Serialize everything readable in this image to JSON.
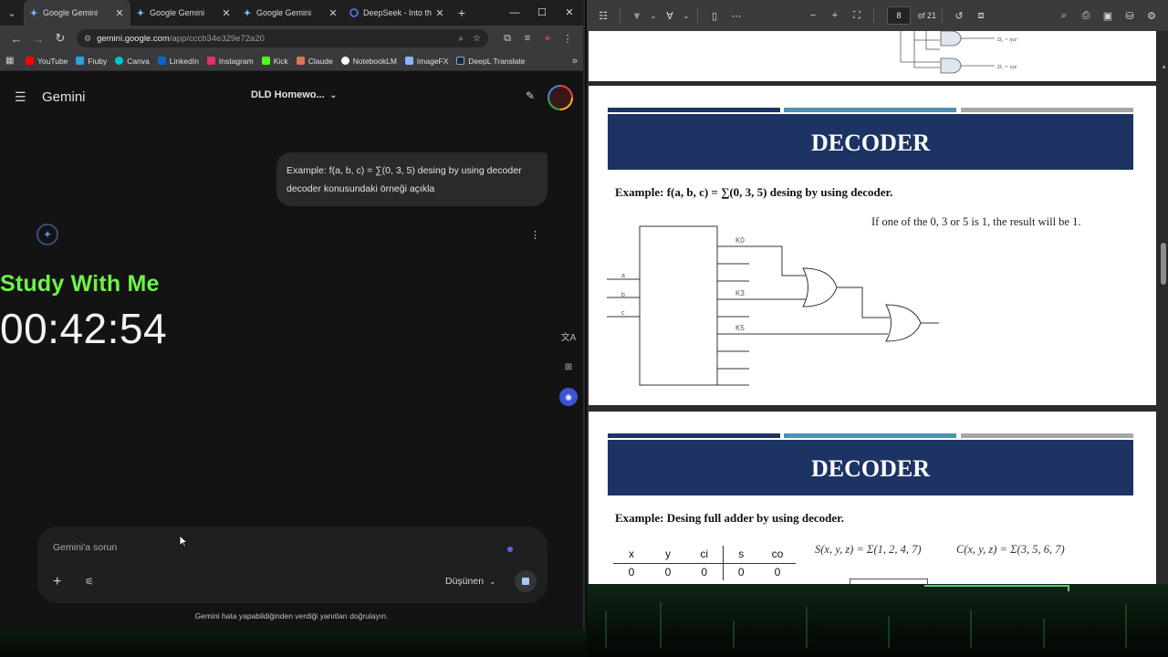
{
  "browser": {
    "tabs": [
      {
        "title": "Google Gemini",
        "active": true
      },
      {
        "title": "Google Gemini",
        "active": false
      },
      {
        "title": "Google Gemini",
        "active": false
      },
      {
        "title": "DeepSeek - Into th",
        "active": false
      }
    ],
    "url_host": "gemini.google.com",
    "url_path": "/app/cccb34e329e72a20",
    "bookmarks": [
      {
        "label": "YouTube",
        "color": "#ff0000"
      },
      {
        "label": "Fiuby",
        "color": "#2aa1e0"
      },
      {
        "label": "Canva",
        "color": "#00c4cc"
      },
      {
        "label": "LinkedIn",
        "color": "#0a66c2"
      },
      {
        "label": "Instagram",
        "color": "#e1306c"
      },
      {
        "label": "Kick",
        "color": "#53fc18"
      },
      {
        "label": "Claude",
        "color": "#d97757"
      },
      {
        "label": "NotebookLM",
        "color": "#ffffff"
      },
      {
        "label": "ImageFX",
        "color": "#8ab4f8"
      },
      {
        "label": "DeepL Translate",
        "color": "#0f2b46"
      }
    ]
  },
  "gemini": {
    "logo": "Gemini",
    "conversation_title": "DLD Homewo...",
    "user_message_line1": "Example: f(a, b, c) = ∑(0, 3, 5) desing by using decoder",
    "user_message_line2": "decoder konusundaki örneği açıkla",
    "prompt_placeholder": "Gemini'a sorun",
    "mode_label": "Düşünen",
    "disclaimer": "Gemini hata yapabildiğinden verdiği yanıtları doğrulayın."
  },
  "overlay": {
    "title": "Study With Me",
    "timer": "00:42:54"
  },
  "pdf": {
    "page_number": "8",
    "page_count": "of 21",
    "top_labels": [
      "D₆ = xyz'",
      "D₇ = xyz"
    ],
    "slide1": {
      "banner": "DECODER",
      "example": "Example: f(a, b, c) = ∑(0, 3, 5) desing by using decoder.",
      "note": "If one of the 0, 3 or 5 is 1, the result will be 1.",
      "inputs": [
        "a",
        "b",
        "c"
      ],
      "outputs": [
        "K0",
        "K3",
        "K5"
      ]
    },
    "slide2": {
      "banner": "DECODER",
      "example": "Example: Desing full adder by using decoder.",
      "table_headers": [
        "x",
        "y",
        "ci",
        "s",
        "co"
      ],
      "table_row": [
        "0",
        "0",
        "0",
        "0",
        "0"
      ],
      "formula_s": "S(x, y, z) = Σ(1, 2, 4, 7)",
      "formula_c": "C(x, y, z) = Σ(3, 5, 6, 7)"
    },
    "bar_colors": [
      "#1c3363",
      "#4f8fb0",
      "#a6a6a6"
    ]
  }
}
